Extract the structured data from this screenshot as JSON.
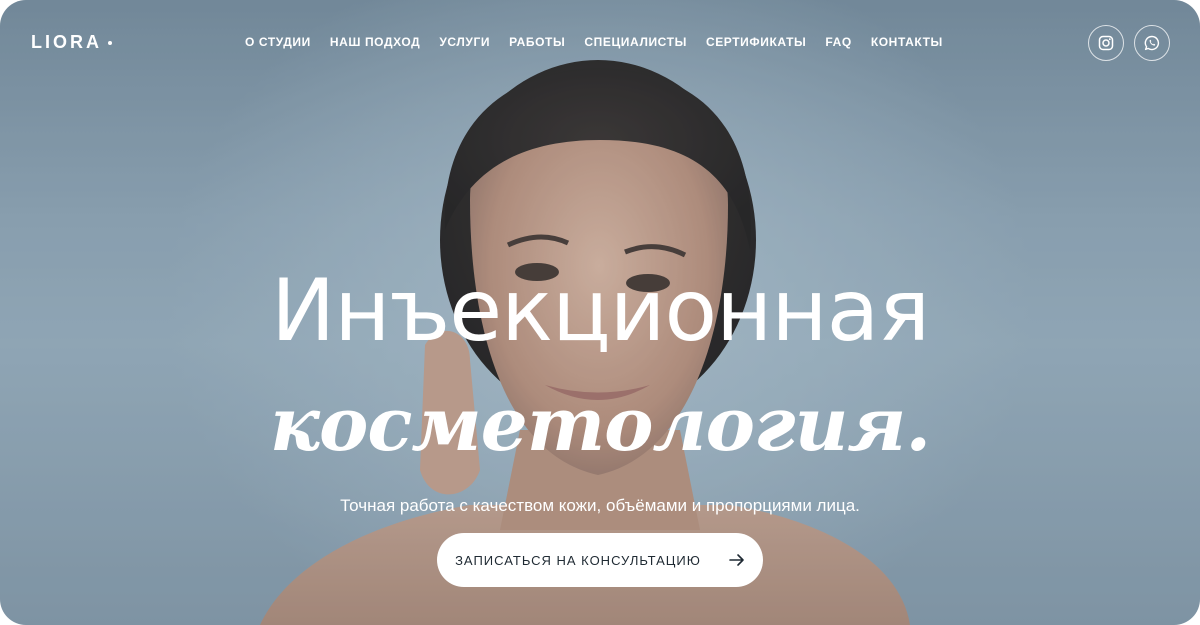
{
  "brand": {
    "logo_text": "LIORA"
  },
  "nav": {
    "items": [
      {
        "label": "О СТУДИИ"
      },
      {
        "label": "НАШ ПОДХОД"
      },
      {
        "label": "УСЛУГИ"
      },
      {
        "label": "РАБОТЫ"
      },
      {
        "label": "СПЕЦИАЛИСТЫ"
      },
      {
        "label": "СЕРТИФИКАТЫ"
      },
      {
        "label": "FAQ"
      },
      {
        "label": "КОНТАКТЫ"
      }
    ]
  },
  "socials": [
    {
      "icon": "instagram-icon"
    },
    {
      "icon": "whatsapp-icon"
    }
  ],
  "hero": {
    "headline_line1": "Инъекционная",
    "headline_line2": "косметология.",
    "subtitle": "Точная работа с качеством кожи, объёмами и пропорциями лица.",
    "cta_label": "ЗАПИСАТЬСЯ НА КОНСУЛЬТАЦИЮ",
    "cta_icon": "arrow-right-icon"
  },
  "colors": {
    "background": "#8aa0b0",
    "text": "#ffffff",
    "button_bg": "#ffffff",
    "button_text": "#1f2a33"
  }
}
